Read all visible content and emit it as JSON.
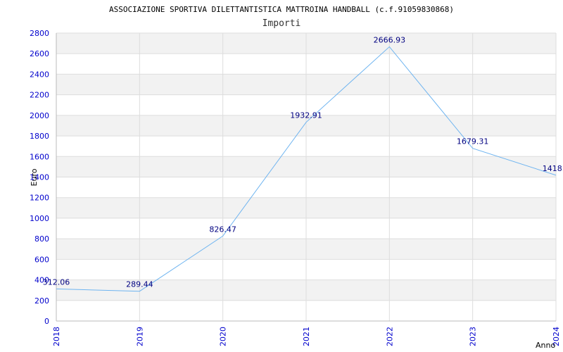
{
  "chart_data": {
    "type": "line",
    "title": "ASSOCIAZIONE SPORTIVA DILETTANTISTICA MATTROINA HANDBALL (c.f.91059830868)",
    "subtitle": "Importi",
    "xlabel": "Anno",
    "ylabel": "Euro",
    "x": [
      "2018",
      "2019",
      "2020",
      "2021",
      "2022",
      "2023",
      "2024"
    ],
    "series": [
      {
        "values": [
          312.06,
          289.44,
          826.47,
          1932.91,
          2666.93,
          1679.31,
          1418.0
        ],
        "labels": [
          "312.06",
          "289.44",
          "826.47",
          "1932.91",
          "2666.93",
          "1679.31",
          "1418.0"
        ]
      }
    ],
    "ylim": [
      0,
      2800
    ],
    "yticks": [
      0,
      200,
      400,
      600,
      800,
      1000,
      1200,
      1400,
      1600,
      1800,
      2000,
      2200,
      2400,
      2600,
      2800
    ],
    "grid": true,
    "colors": {
      "line": "#6eb4f0",
      "band": "#f2f2f2",
      "gridline": "#dddddd",
      "tick_text": "#0000cc",
      "data_label": "#000080"
    }
  }
}
